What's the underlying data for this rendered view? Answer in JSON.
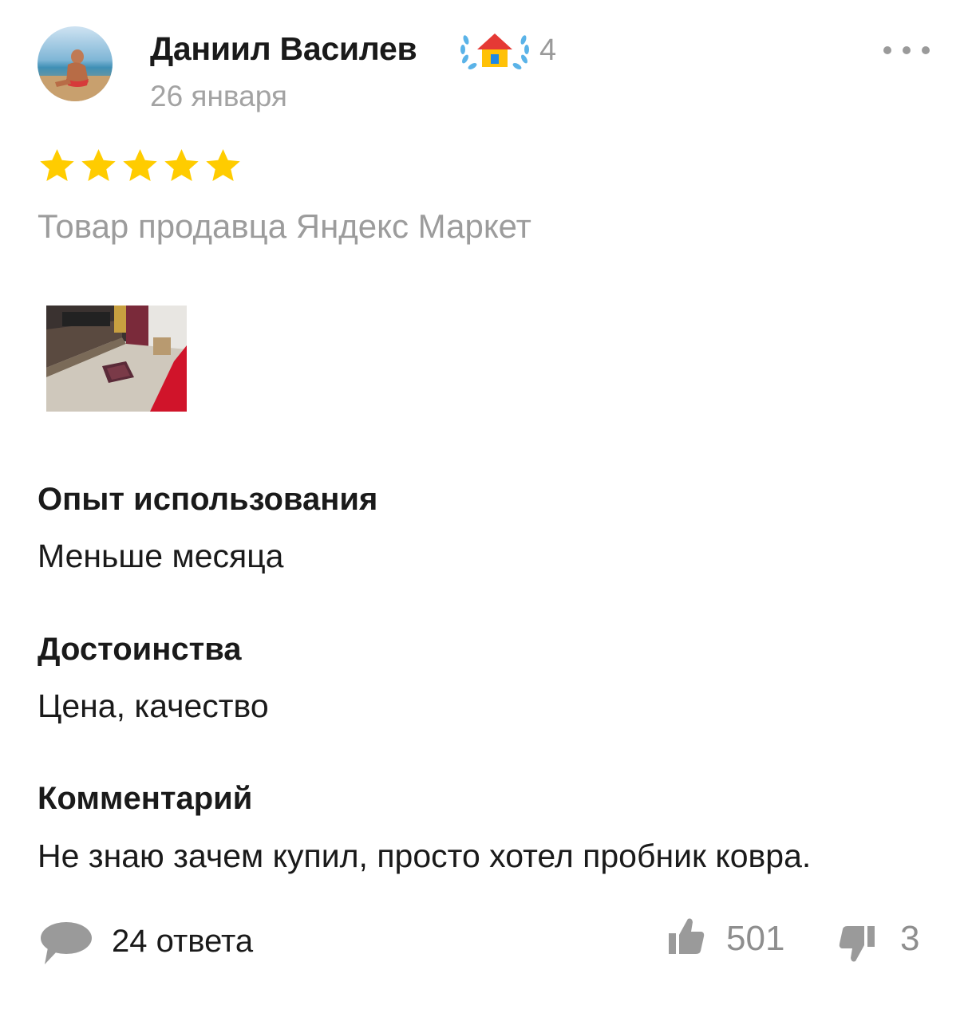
{
  "review": {
    "author": {
      "name": "Даниил Василев",
      "badge_icon": "house-laurel-icon",
      "badge_count": "4",
      "avatar_icon": "avatar-photo"
    },
    "date": "26 января",
    "rating": 5,
    "rating_max": 5,
    "seller_note": "Товар продавца Яндекс Маркет",
    "photos": [
      "room-carpet-photo"
    ],
    "sections": [
      {
        "title": "Опыт использования",
        "text": "Меньше месяца"
      },
      {
        "title": "Достоинства",
        "text": "Цена, качество"
      },
      {
        "title": "Комментарий",
        "text": "Не знаю зачем купил, просто хотел пробник ковра."
      }
    ],
    "footer": {
      "comments_label": "24 ответа",
      "likes": "501",
      "dislikes": "3"
    }
  },
  "colors": {
    "star": "#FFCC00",
    "muted_text": "#9C9C9C",
    "laurel": "#5AB3E8",
    "house_roof": "#E53935",
    "icon_gray": "#9A9A9A"
  }
}
